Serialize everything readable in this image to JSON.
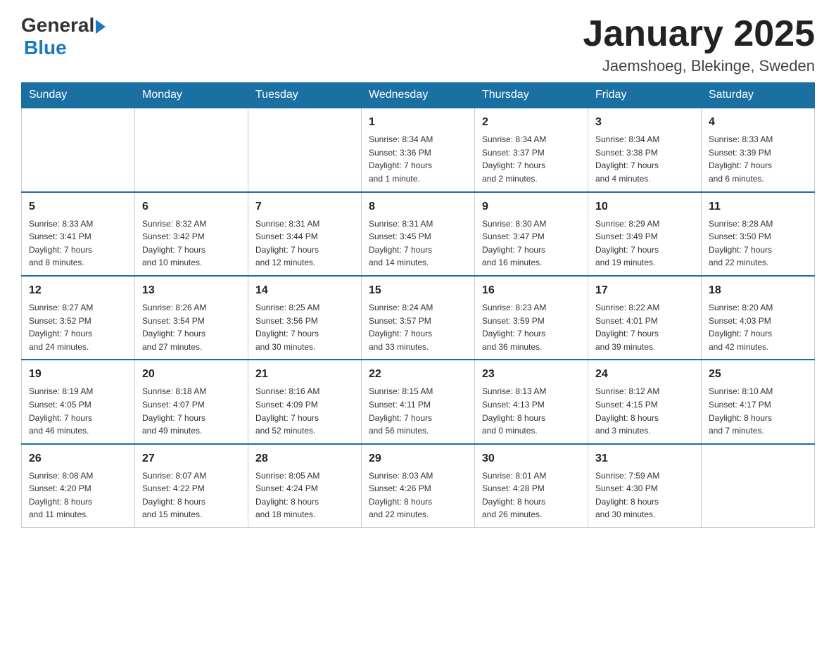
{
  "header": {
    "logo_general": "General",
    "logo_blue": "Blue",
    "title": "January 2025",
    "subtitle": "Jaemshoeg, Blekinge, Sweden"
  },
  "weekdays": [
    "Sunday",
    "Monday",
    "Tuesday",
    "Wednesday",
    "Thursday",
    "Friday",
    "Saturday"
  ],
  "weeks": [
    [
      {
        "day": "",
        "info": ""
      },
      {
        "day": "",
        "info": ""
      },
      {
        "day": "",
        "info": ""
      },
      {
        "day": "1",
        "info": "Sunrise: 8:34 AM\nSunset: 3:36 PM\nDaylight: 7 hours\nand 1 minute."
      },
      {
        "day": "2",
        "info": "Sunrise: 8:34 AM\nSunset: 3:37 PM\nDaylight: 7 hours\nand 2 minutes."
      },
      {
        "day": "3",
        "info": "Sunrise: 8:34 AM\nSunset: 3:38 PM\nDaylight: 7 hours\nand 4 minutes."
      },
      {
        "day": "4",
        "info": "Sunrise: 8:33 AM\nSunset: 3:39 PM\nDaylight: 7 hours\nand 6 minutes."
      }
    ],
    [
      {
        "day": "5",
        "info": "Sunrise: 8:33 AM\nSunset: 3:41 PM\nDaylight: 7 hours\nand 8 minutes."
      },
      {
        "day": "6",
        "info": "Sunrise: 8:32 AM\nSunset: 3:42 PM\nDaylight: 7 hours\nand 10 minutes."
      },
      {
        "day": "7",
        "info": "Sunrise: 8:31 AM\nSunset: 3:44 PM\nDaylight: 7 hours\nand 12 minutes."
      },
      {
        "day": "8",
        "info": "Sunrise: 8:31 AM\nSunset: 3:45 PM\nDaylight: 7 hours\nand 14 minutes."
      },
      {
        "day": "9",
        "info": "Sunrise: 8:30 AM\nSunset: 3:47 PM\nDaylight: 7 hours\nand 16 minutes."
      },
      {
        "day": "10",
        "info": "Sunrise: 8:29 AM\nSunset: 3:49 PM\nDaylight: 7 hours\nand 19 minutes."
      },
      {
        "day": "11",
        "info": "Sunrise: 8:28 AM\nSunset: 3:50 PM\nDaylight: 7 hours\nand 22 minutes."
      }
    ],
    [
      {
        "day": "12",
        "info": "Sunrise: 8:27 AM\nSunset: 3:52 PM\nDaylight: 7 hours\nand 24 minutes."
      },
      {
        "day": "13",
        "info": "Sunrise: 8:26 AM\nSunset: 3:54 PM\nDaylight: 7 hours\nand 27 minutes."
      },
      {
        "day": "14",
        "info": "Sunrise: 8:25 AM\nSunset: 3:56 PM\nDaylight: 7 hours\nand 30 minutes."
      },
      {
        "day": "15",
        "info": "Sunrise: 8:24 AM\nSunset: 3:57 PM\nDaylight: 7 hours\nand 33 minutes."
      },
      {
        "day": "16",
        "info": "Sunrise: 8:23 AM\nSunset: 3:59 PM\nDaylight: 7 hours\nand 36 minutes."
      },
      {
        "day": "17",
        "info": "Sunrise: 8:22 AM\nSunset: 4:01 PM\nDaylight: 7 hours\nand 39 minutes."
      },
      {
        "day": "18",
        "info": "Sunrise: 8:20 AM\nSunset: 4:03 PM\nDaylight: 7 hours\nand 42 minutes."
      }
    ],
    [
      {
        "day": "19",
        "info": "Sunrise: 8:19 AM\nSunset: 4:05 PM\nDaylight: 7 hours\nand 46 minutes."
      },
      {
        "day": "20",
        "info": "Sunrise: 8:18 AM\nSunset: 4:07 PM\nDaylight: 7 hours\nand 49 minutes."
      },
      {
        "day": "21",
        "info": "Sunrise: 8:16 AM\nSunset: 4:09 PM\nDaylight: 7 hours\nand 52 minutes."
      },
      {
        "day": "22",
        "info": "Sunrise: 8:15 AM\nSunset: 4:11 PM\nDaylight: 7 hours\nand 56 minutes."
      },
      {
        "day": "23",
        "info": "Sunrise: 8:13 AM\nSunset: 4:13 PM\nDaylight: 8 hours\nand 0 minutes."
      },
      {
        "day": "24",
        "info": "Sunrise: 8:12 AM\nSunset: 4:15 PM\nDaylight: 8 hours\nand 3 minutes."
      },
      {
        "day": "25",
        "info": "Sunrise: 8:10 AM\nSunset: 4:17 PM\nDaylight: 8 hours\nand 7 minutes."
      }
    ],
    [
      {
        "day": "26",
        "info": "Sunrise: 8:08 AM\nSunset: 4:20 PM\nDaylight: 8 hours\nand 11 minutes."
      },
      {
        "day": "27",
        "info": "Sunrise: 8:07 AM\nSunset: 4:22 PM\nDaylight: 8 hours\nand 15 minutes."
      },
      {
        "day": "28",
        "info": "Sunrise: 8:05 AM\nSunset: 4:24 PM\nDaylight: 8 hours\nand 18 minutes."
      },
      {
        "day": "29",
        "info": "Sunrise: 8:03 AM\nSunset: 4:26 PM\nDaylight: 8 hours\nand 22 minutes."
      },
      {
        "day": "30",
        "info": "Sunrise: 8:01 AM\nSunset: 4:28 PM\nDaylight: 8 hours\nand 26 minutes."
      },
      {
        "day": "31",
        "info": "Sunrise: 7:59 AM\nSunset: 4:30 PM\nDaylight: 8 hours\nand 30 minutes."
      },
      {
        "day": "",
        "info": ""
      }
    ]
  ]
}
